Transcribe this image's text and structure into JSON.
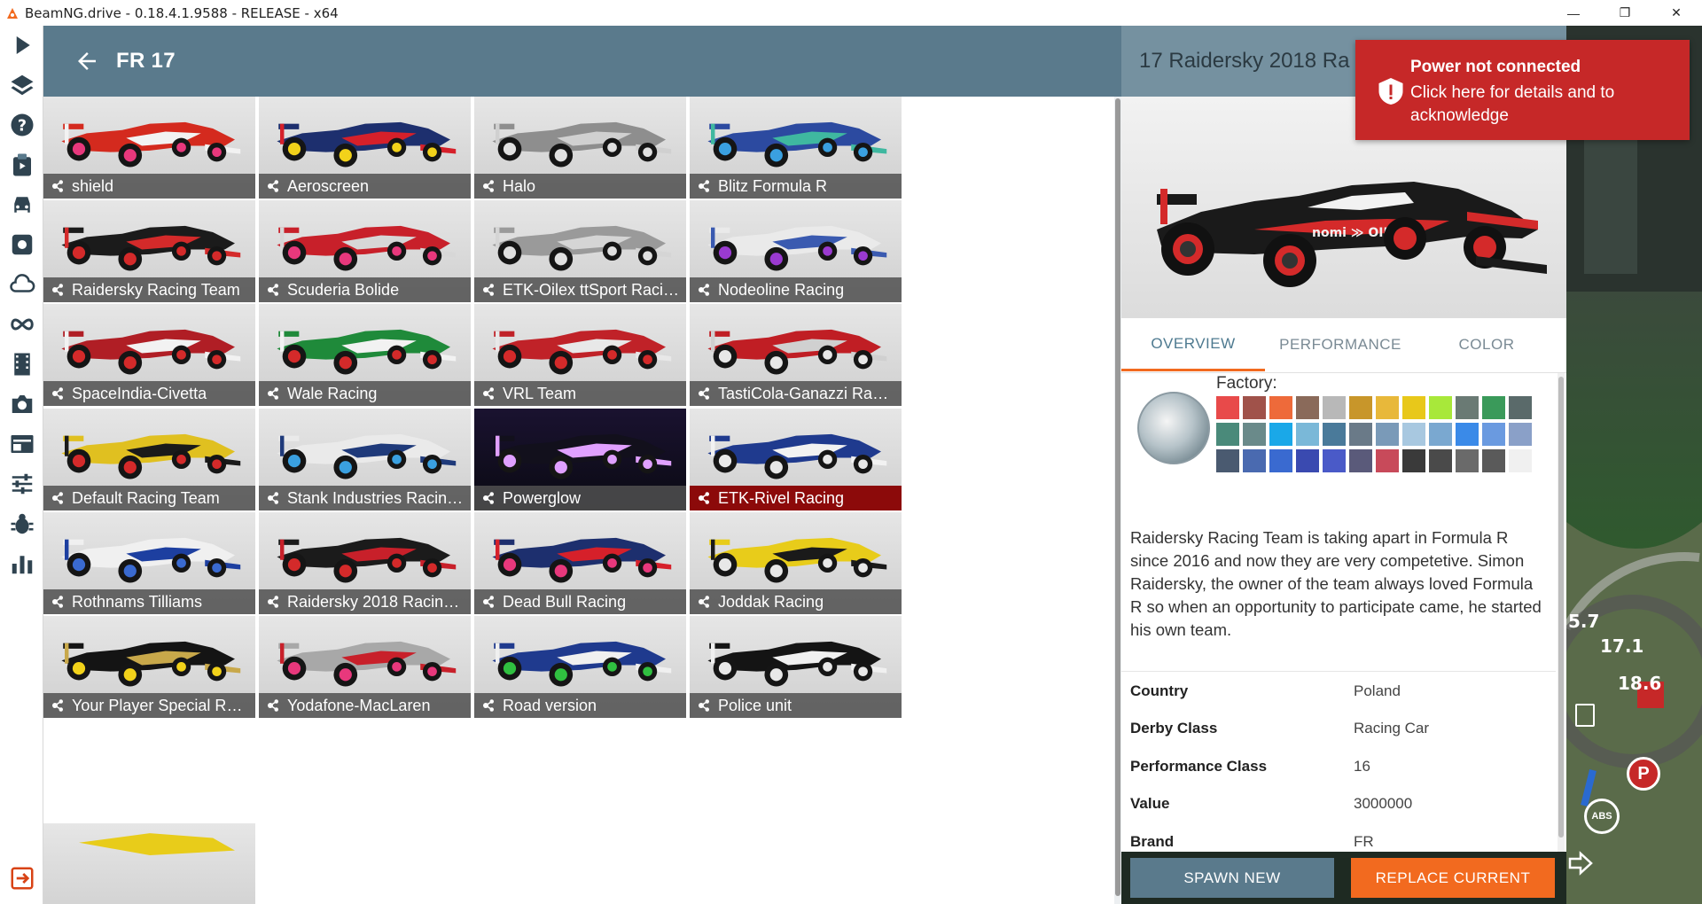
{
  "window": {
    "title": "BeamNG.drive - 0.18.4.1.9588 - RELEASE - x64",
    "min": "—",
    "max": "❐",
    "close": "✕"
  },
  "sidebar": {
    "items": [
      "play-icon",
      "layers-icon",
      "help-icon",
      "clipboard-icon",
      "car-icon",
      "settings-icon",
      "cloud-icon",
      "infinity-icon",
      "film-icon",
      "camera-icon",
      "layout-icon",
      "sliders-icon",
      "bug-icon",
      "stats-icon",
      "exit-icon"
    ]
  },
  "header": {
    "title": "FR 17"
  },
  "tiles": [
    {
      "label": "shield",
      "body": "#d42a1e",
      "accent": "#f2f2f2",
      "wheel": "#e8387c"
    },
    {
      "label": "Aeroscreen",
      "body": "#1d2f6e",
      "accent": "#d6202a",
      "wheel": "#f2d21a"
    },
    {
      "label": "Halo",
      "body": "#8e8e8e",
      "accent": "#d0d0d0",
      "wheel": "#e0e0e0"
    },
    {
      "label": "Blitz Formula R",
      "body": "#2c4aa0",
      "accent": "#3fb8a0",
      "wheel": "#3aa0e0"
    },
    {
      "label": "Raidersky Racing Team",
      "body": "#1b1b1b",
      "accent": "#d42a2a",
      "wheel": "#d42a2a"
    },
    {
      "label": "Scuderia Bolide",
      "body": "#c8202a",
      "accent": "#d7d7d7",
      "wheel": "#e8387c"
    },
    {
      "label": "ETK-Oilex ttSport Racing T...",
      "body": "#9a9a9a",
      "accent": "#d5d5d5",
      "wheel": "#e0e0e0"
    },
    {
      "label": "Nodeoline Racing",
      "body": "#eaeaea",
      "accent": "#3a5ab0",
      "wheel": "#9a3ad0"
    },
    {
      "label": "SpaceIndia-Civetta",
      "body": "#b01e25",
      "accent": "#f2f2f2",
      "wheel": "#d42a2a"
    },
    {
      "label": "Wale Racing",
      "body": "#1f8a3a",
      "accent": "#f2f2f2",
      "wheel": "#d42a2a"
    },
    {
      "label": "VRL Team",
      "body": "#c02228",
      "accent": "#e8e8e8",
      "wheel": "#d42a2a"
    },
    {
      "label": "TastiCola-Ganazzi Racing ...",
      "body": "#c01e24",
      "accent": "#d0d0d0",
      "wheel": "#e8e8e8"
    },
    {
      "label": "Default Racing Team",
      "body": "#e0c020",
      "accent": "#1a1a1a",
      "wheel": "#d42a2a"
    },
    {
      "label": "Stank Industries Racing T...",
      "body": "#eaeaea",
      "accent": "#1f3a7a",
      "wheel": "#3aa0e0"
    },
    {
      "label": "Powerglow",
      "body": "#12101c",
      "accent": "#e0a0ff",
      "wheel": "#e0a0ff",
      "dark": true
    },
    {
      "label": "ETK-Rivel Racing",
      "body": "#1f3a8e",
      "accent": "#f2f2f2",
      "wheel": "#e8e8e8",
      "selected": true
    },
    {
      "label": "Rothnams Tilliams",
      "body": "#f0f0f0",
      "accent": "#1d3fa0",
      "wheel": "#3a6ad0"
    },
    {
      "label": "Raidersky 2018 Racing Te...",
      "body": "#1b1b1b",
      "accent": "#c8202a",
      "wheel": "#d42a2a"
    },
    {
      "label": "Dead Bull Racing",
      "body": "#1d2f6e",
      "accent": "#d6202a",
      "wheel": "#e8387c"
    },
    {
      "label": "Joddak Racing",
      "body": "#e8cc1a",
      "accent": "#1a1a1a",
      "wheel": "#e8e8e8"
    },
    {
      "label": "Your Player Special Racing",
      "body": "#141414",
      "accent": "#c8a84a",
      "wheel": "#f2d21a"
    },
    {
      "label": "Yodafone-MacLaren",
      "body": "#a8a8a8",
      "accent": "#c8202a",
      "wheel": "#e8387c"
    },
    {
      "label": "Road version",
      "body": "#1f3a8e",
      "accent": "#f0f0f0",
      "wheel": "#30c040"
    },
    {
      "label": "Police unit",
      "body": "#141414",
      "accent": "#f0f0f0",
      "wheel": "#e8e8e8"
    }
  ],
  "detail": {
    "title": "17 Raidersky 2018 Ra",
    "tabs": [
      "OVERVIEW",
      "PERFORMANCE",
      "COLOR"
    ],
    "factory_label": "Factory:",
    "description": "Raidersky Racing Team is taking apart in Formula R since 2016 and now they are very competetive. Simon Raidersky, the owner of the team always loved Formula R so when an opportunity to participate came, he started his own team.",
    "properties": [
      {
        "key": "Country",
        "value": "Poland"
      },
      {
        "key": "Derby Class",
        "value": "Racing Car"
      },
      {
        "key": "Performance Class",
        "value": "16"
      },
      {
        "key": "Value",
        "value": "3000000"
      },
      {
        "key": "Brand",
        "value": "FR"
      }
    ],
    "spawn_label": "SPAWN NEW",
    "replace_label": "REPLACE CURRENT",
    "swatches": [
      "#e84a4a",
      "#a0524a",
      "#ee6a3a",
      "#8a6a5a",
      "#b8b8b8",
      "#c8962a",
      "#e8b83a",
      "#e8c81a",
      "#a8e83a",
      "#6a7a74",
      "#3a9a5a",
      "#5a6a6a",
      "#4a8a7a",
      "#6a8a8a",
      "#1aa8e8",
      "#7ab8d8",
      "#4a7a9a",
      "#6a7a88",
      "#7a9ab8",
      "#a8c8e0",
      "#7aa8d0",
      "#3a8ae8",
      "#6a9ae0",
      "#8aa0c8",
      "#4a5a70",
      "#4a6ab0",
      "#3a6ad0",
      "#3a4ab0",
      "#4a5ac8",
      "#5a5a7a",
      "#c84a5a",
      "#3a3a3a",
      "#4a4a4a",
      "#6a6a6a",
      "#5a5a5a",
      "#f0f0f0"
    ]
  },
  "notification": {
    "title": "Power not connected",
    "body": "Click here for details and to acknowledge"
  },
  "hud": {
    "v1": "5.7",
    "v2": "17.1",
    "v3": "18.6",
    "gear": "P",
    "abs": "ABS"
  }
}
